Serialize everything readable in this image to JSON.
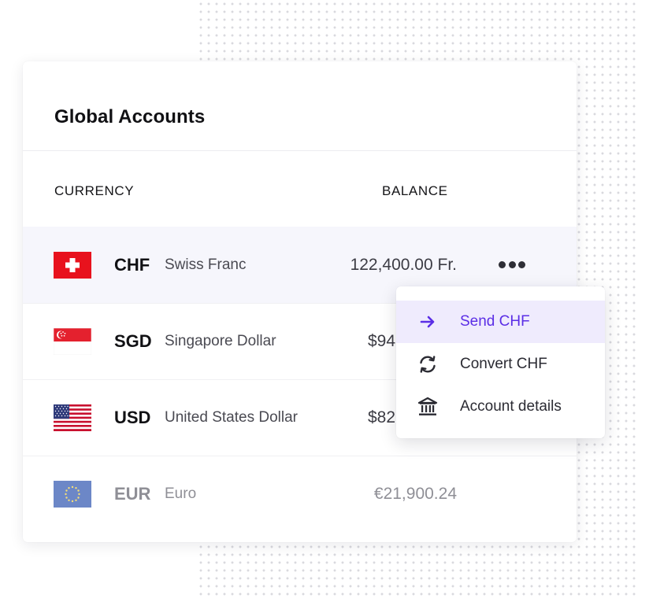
{
  "card": {
    "title": "Global Accounts",
    "columns": {
      "currency": "CURRENCY",
      "balance": "BALANCE"
    }
  },
  "accounts": [
    {
      "code": "CHF",
      "name": "Swiss Franc",
      "balance": "122,400.00 Fr.",
      "flag": "switzerland-flag",
      "selected": true
    },
    {
      "code": "SGD",
      "name": "Singapore Dollar",
      "balance": "$94",
      "flag": "singapore-flag"
    },
    {
      "code": "USD",
      "name": "United States Dollar",
      "balance": "$82",
      "flag": "usa-flag"
    },
    {
      "code": "EUR",
      "name": "Euro",
      "balance": "€21,900.24",
      "flag": "eu-flag",
      "muted": true
    }
  ],
  "menu": {
    "items": [
      {
        "label": "Send CHF",
        "icon": "arrow-right-icon",
        "active": true
      },
      {
        "label": "Convert CHF",
        "icon": "convert-icon"
      },
      {
        "label": "Account details",
        "icon": "bank-icon"
      }
    ]
  },
  "colors": {
    "accent": "#5b2ee6",
    "selected_row": "#f6f6fc",
    "menu_active": "#efebfd"
  },
  "more_icon": "more-horizontal-icon"
}
